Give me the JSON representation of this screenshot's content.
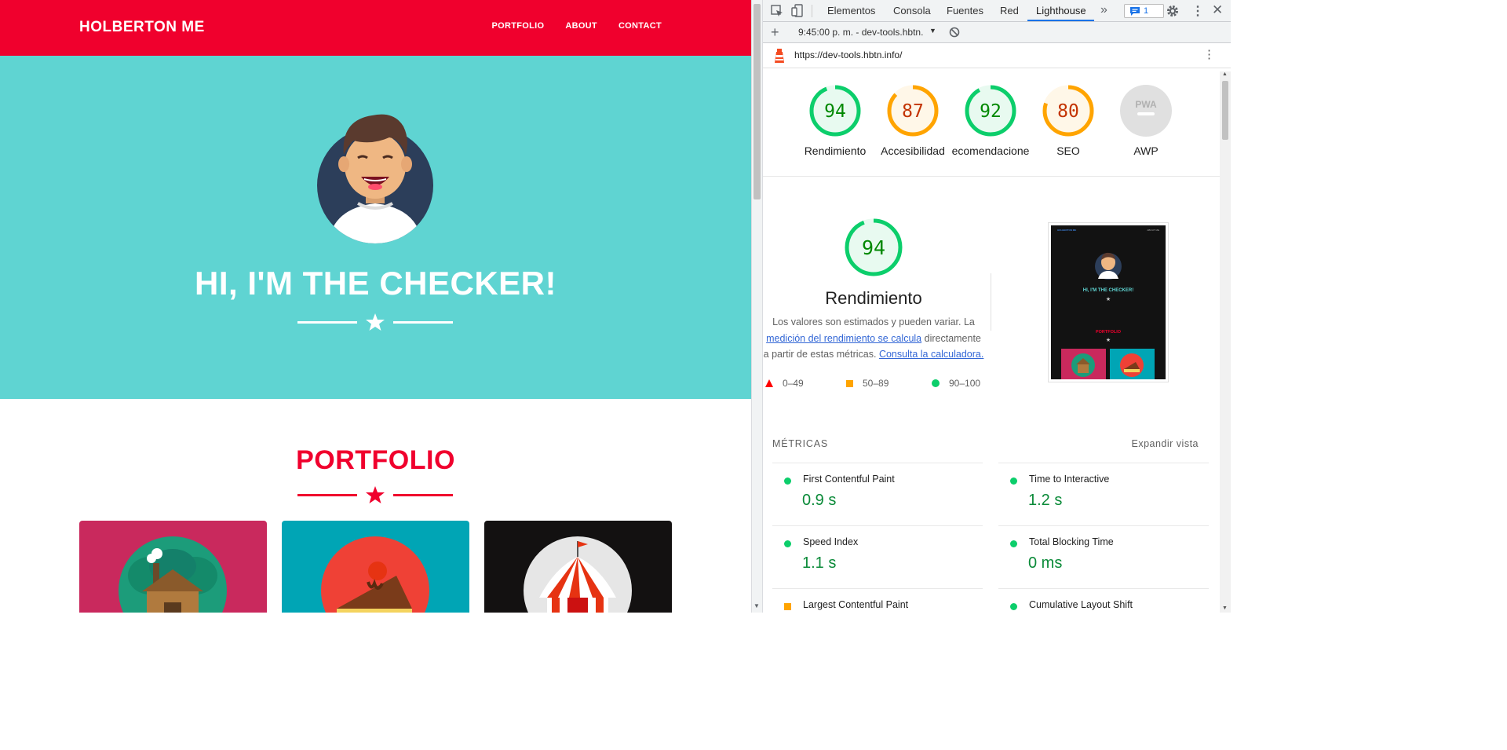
{
  "site": {
    "brand": "HOLBERTON ME",
    "nav": [
      "PORTFOLIO",
      "ABOUT",
      "CONTACT"
    ],
    "hero_title": "HI, I'M THE CHECKER!",
    "portfolio_title": "PORTFOLIO",
    "colors": {
      "red": "#f0002d",
      "teal": "#5fd4d2",
      "card1": "#c9295d",
      "card2": "#00a5b5",
      "card3": "#131111"
    }
  },
  "devtools": {
    "tabs": [
      "Elementos",
      "Consola",
      "Fuentes",
      "Red",
      "Lighthouse"
    ],
    "active_tab": "Lighthouse",
    "issues_count": "1",
    "report_time": "9:45:00 p. m. - dev-tools.hbtn.",
    "url": "https://dev-tools.hbtn.info/",
    "gauges": [
      {
        "score": "94",
        "label": "Rendimiento",
        "color": "#0cce6b",
        "text_color": "#008800",
        "fill": 0.94
      },
      {
        "score": "87",
        "label": "Accesibilidad",
        "color": "#ffa400",
        "text_color": "#c33300",
        "fill": 0.87
      },
      {
        "score": "92",
        "label": "ecomendacione",
        "color": "#0cce6b",
        "text_color": "#008800",
        "fill": 0.92
      },
      {
        "score": "80",
        "label": "SEO",
        "color": "#ffa400",
        "text_color": "#c33300",
        "fill": 0.8
      },
      {
        "score": "PWA",
        "label": "AWP",
        "color": "#cccccc",
        "text_color": "#999999",
        "fill": 0
      }
    ],
    "performance": {
      "score": "94",
      "fill": 0.94,
      "title": "Rendimiento",
      "desc_1": "Los valores son estimados y pueden variar. La",
      "desc_link_1": "medición del rendimiento se calcula",
      "desc_2": "directamente a partir de estas métricas.",
      "desc_link_2": "Consulta la calculadora.",
      "legend": [
        "0–49",
        "50–89",
        "90–100"
      ]
    },
    "thumbnail": {
      "hero_title": "HI, I'M THE CHECKER!",
      "portfolio_title": "PORTFOLIO",
      "brand": "HOLBERTON ME",
      "nav": "ABOUT ME"
    },
    "metrics_title": "MÉTRICAS",
    "expand_label": "Expandir vista",
    "metrics": [
      {
        "name": "First Contentful Paint",
        "value": "0.9 s"
      },
      {
        "name": "Time to Interactive",
        "value": "1.2 s"
      },
      {
        "name": "Speed Index",
        "value": "1.1 s"
      },
      {
        "name": "Total Blocking Time",
        "value": "0 ms"
      },
      {
        "name": "Largest Contentful Paint",
        "value": ""
      },
      {
        "name": "Cumulative Layout Shift",
        "value": ""
      }
    ]
  }
}
